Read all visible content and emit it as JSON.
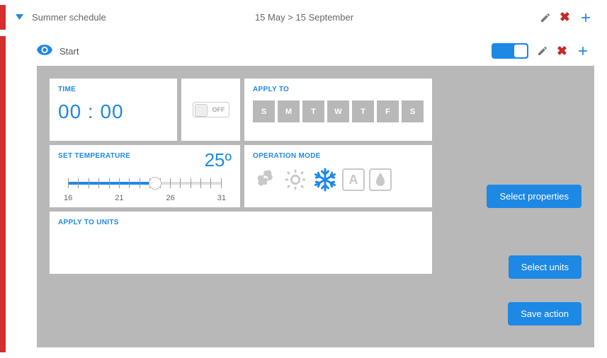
{
  "schedule": {
    "title": "Summer schedule",
    "date_range": "15 May > 15 September"
  },
  "action": {
    "title": "Start"
  },
  "time_card": {
    "label": "TIME",
    "value": "00 : 00"
  },
  "off_toggle": {
    "label": "OFF"
  },
  "apply_to": {
    "label": "APPLY TO",
    "days": [
      "S",
      "M",
      "T",
      "W",
      "T",
      "F",
      "S"
    ]
  },
  "temperature": {
    "label": "SET TEMPERATURE",
    "value_display": "25º",
    "scale": {
      "t0": "16",
      "t1": "21",
      "t2": "26",
      "t3": "31"
    }
  },
  "operation_mode": {
    "label": "OPERATION MODE",
    "auto_letter": "A"
  },
  "apply_units": {
    "label": "APPLY TO UNITS"
  },
  "buttons": {
    "select_properties": "Select properties",
    "select_units": "Select units",
    "save_action": "Save action"
  }
}
